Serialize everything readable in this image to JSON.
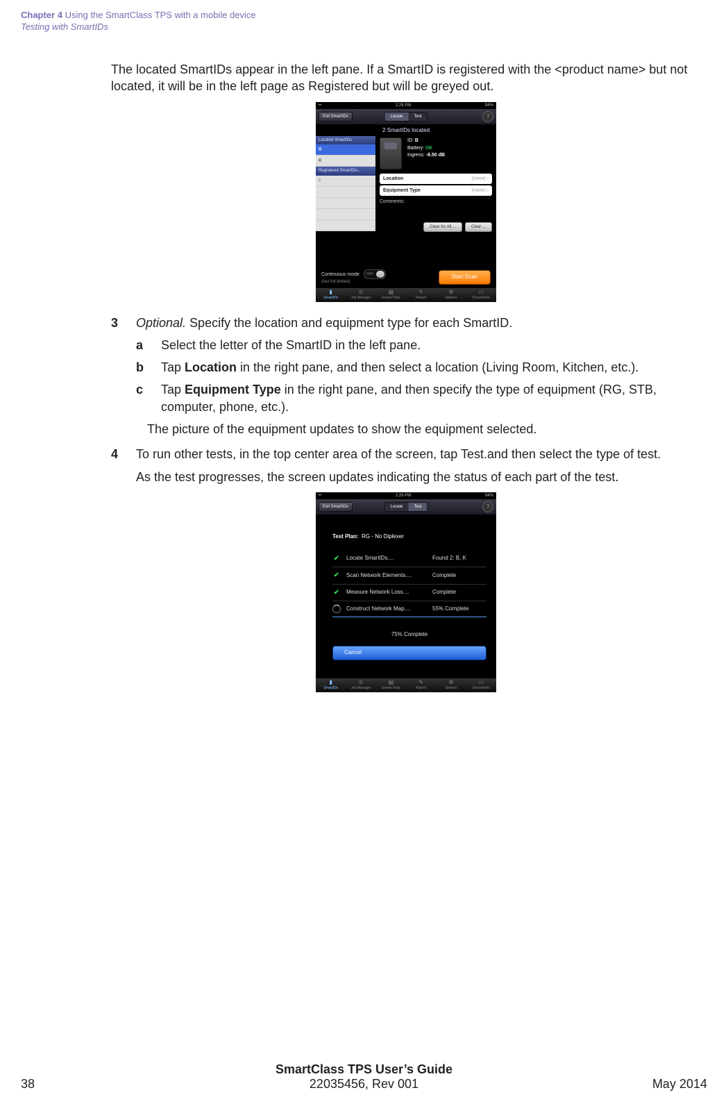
{
  "header": {
    "chapter": "Chapter 4",
    "chapter_title": "Using the SmartClass TPS  with a mobile device",
    "section_italic": "Testing with SmartIDs"
  },
  "intro": "The located SmartIDs appear in the left pane. If a SmartID is registered with the <product name> but not located, it will be in the left page as Registered but will be greyed out.",
  "step3": {
    "num": "3",
    "lead_italic": "Optional.",
    "lead_rest": " Specify the location and equipment type for each SmartID.",
    "a": {
      "letter": "a",
      "text": "Select the letter of the SmartID in the left pane."
    },
    "b": {
      "letter": "b",
      "pre": "Tap ",
      "bold": "Location",
      "post": " in the right pane, and then select a location (Living Room, Kitchen, etc.)."
    },
    "c": {
      "letter": "c",
      "pre": "Tap ",
      "bold": "Equipment Type",
      "post": " in the right pane, and then specify the type of equipment (RG, STB, computer, phone, etc.)."
    },
    "followup": "The picture of the equipment updates to show the equipment selected."
  },
  "step4": {
    "num": "4",
    "text": "To run other tests, in the top center area of the screen, tap Test.and then select the type of test.",
    "followup": "As the test progresses, the screen updates indicating the status of each part of the test."
  },
  "footer": {
    "title": "SmartClass TPS User’s Guide",
    "docnum": "22035456, Rev 001",
    "page": "38",
    "date": "May 2014"
  },
  "shot1": {
    "status_time": "2:26 PM",
    "status_batt": "94%",
    "exit": "Exit SmartIDs",
    "seg_locate": "Locate",
    "seg_test": "Test",
    "help": "?",
    "subtitle": "2 SmartIDs located",
    "left": {
      "located_hdr": "Located SmartIDs",
      "rowB": "B",
      "rowK": "K",
      "reg_hdr": "Registered SmartIDs...",
      "rowF": "F"
    },
    "info": {
      "id_label": "ID:",
      "id_value": "B",
      "batt_label": "Battery:",
      "batt_value": "OK",
      "ing_label": "Ingress:",
      "ing_value": "-6.50 dB"
    },
    "fields": {
      "location_label": "Location",
      "location_value": "(none)  ›",
      "equip_label": "Equipment Type",
      "equip_value": "(none)  ›"
    },
    "comments": "Comments:",
    "clear_all": "Clear for All ...",
    "clear": "Clear ...",
    "cont_mode": "Continuous mode",
    "cont_sub": "(last full limited)",
    "toggle_off": "OFF",
    "start": "Start Scan",
    "tabs": [
      "SmartIDs",
      "Job Manager",
      "Saved Tests",
      "Report",
      "Options",
      "Documents"
    ]
  },
  "shot2": {
    "status_time": "2:26 PM",
    "status_batt": "94%",
    "exit": "Exit SmartIDs",
    "seg_locate": "Locate",
    "seg_test": "Test",
    "help": "?",
    "plan_label": "Test Plan:",
    "plan_value": "RG - No Diplexer",
    "steps": [
      {
        "name": "Locate SmartIDs....",
        "status": "Found 2:  B, K",
        "done": true
      },
      {
        "name": "Scan Network Elements....",
        "status": "Complete",
        "done": true
      },
      {
        "name": "Measure Network Loss....",
        "status": "Complete",
        "done": true
      },
      {
        "name": "Construct Network Map....",
        "status": "55% Complete",
        "done": false
      }
    ],
    "overall": "75% Complete",
    "cancel": "Cancel",
    "tabs": [
      "SmartIDs",
      "Job Manager",
      "Saved Tests",
      "Report",
      "Options",
      "Documents"
    ]
  }
}
